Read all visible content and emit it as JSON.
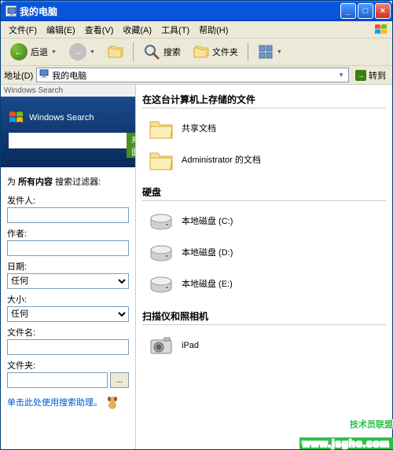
{
  "window": {
    "title": "我的电脑"
  },
  "menu": {
    "file": "文件(F)",
    "edit": "编辑(E)",
    "view": "查看(V)",
    "favorites": "收藏(A)",
    "tools": "工具(T)",
    "help": "帮助(H)"
  },
  "toolbar": {
    "back": "后退",
    "search": "搜索",
    "folders": "文件夹"
  },
  "address": {
    "label": "地址(D)",
    "value": "我的电脑",
    "go": "转到"
  },
  "sidebar": {
    "ws_label": "Windows Search",
    "ws_title": "Windows Search",
    "ws_btn": "桌面",
    "filter_title_prefix": "为 ",
    "filter_title_bold": "所有内容",
    "filter_title_suffix": " 搜索过滤器:",
    "fields": {
      "sender": "发件人:",
      "author": "作者:",
      "date": "日期:",
      "date_val": "任何",
      "size": "大小:",
      "size_val": "任何",
      "filename": "文件名:",
      "folder": "文件夹:"
    },
    "helper": "单击此处使用搜索助理。"
  },
  "main": {
    "sections": [
      {
        "title": "在这台计算机上存储的文件",
        "items": [
          {
            "icon": "folder",
            "label": "共享文档"
          },
          {
            "icon": "folder",
            "label": "Administrator 的文档"
          }
        ]
      },
      {
        "title": "硬盘",
        "items": [
          {
            "icon": "drive",
            "label": "本地磁盘 (C:)"
          },
          {
            "icon": "drive",
            "label": "本地磁盘 (D:)"
          },
          {
            "icon": "drive",
            "label": "本地磁盘 (E:)"
          }
        ]
      },
      {
        "title": "扫描仪和照相机",
        "items": [
          {
            "icon": "camera",
            "label": "iPad"
          }
        ]
      }
    ]
  },
  "watermark": {
    "text": "技术员联盟",
    "url": "www.jsgho.com"
  }
}
